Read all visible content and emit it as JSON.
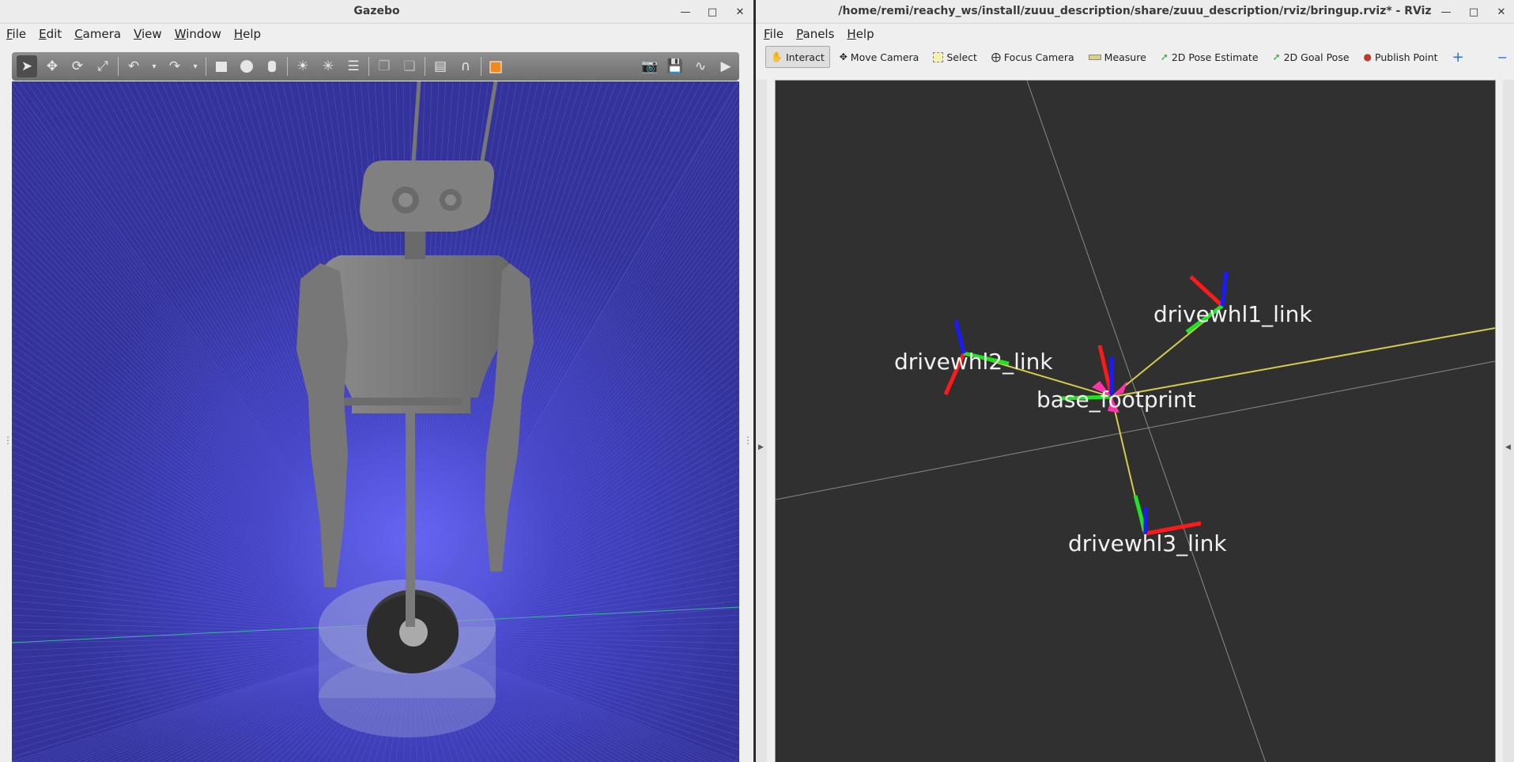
{
  "gazebo": {
    "title": "Gazebo",
    "menu": [
      "File",
      "Edit",
      "Camera",
      "View",
      "Window",
      "Help"
    ],
    "toolbar_icons": [
      "select-arrow-icon",
      "translate-icon",
      "rotate-icon",
      "scale-icon",
      "undo-icon",
      "undo-dropdown-icon",
      "redo-icon",
      "redo-dropdown-icon",
      "box-icon",
      "sphere-icon",
      "cylinder-icon",
      "point-light-icon",
      "spot-light-icon",
      "directional-light-icon",
      "copy-icon",
      "paste-icon",
      "align-icon",
      "magnet-icon",
      "color-box-icon",
      "screenshot-icon",
      "log-icon",
      "plot-icon",
      "video-record-icon"
    ],
    "colors": {
      "ground": "#3f3fb8",
      "grid": "#5a5ad0",
      "robot": "#7e7e7e"
    }
  },
  "rviz": {
    "title": "/home/remi/reachy_ws/install/zuuu_description/share/zuuu_description/rviz/bringup.rviz* - RViz",
    "menu": [
      "File",
      "Panels",
      "Help"
    ],
    "tools": [
      {
        "label": "Interact",
        "icon": "hand-icon"
      },
      {
        "label": "Move Camera",
        "icon": "move-camera-icon"
      },
      {
        "label": "Select",
        "icon": "select-box-icon"
      },
      {
        "label": "Focus Camera",
        "icon": "focus-camera-icon"
      },
      {
        "label": "Measure",
        "icon": "ruler-icon"
      },
      {
        "label": "2D Pose Estimate",
        "icon": "green-arrow-icon"
      },
      {
        "label": "2D Goal Pose",
        "icon": "green-arrow-icon"
      },
      {
        "label": "Publish Point",
        "icon": "map-pin-icon"
      }
    ],
    "frames": [
      "drivewhl1_link",
      "drivewhl2_link",
      "base_footprint",
      "drivewhl3_link"
    ],
    "colors": {
      "background": "#303030",
      "tf_link": "#d4cc4a",
      "x_axis": "#ff1a1a",
      "y_axis": "#22e022",
      "z_axis": "#1a1aff",
      "arrow": "#ff33aa"
    }
  }
}
